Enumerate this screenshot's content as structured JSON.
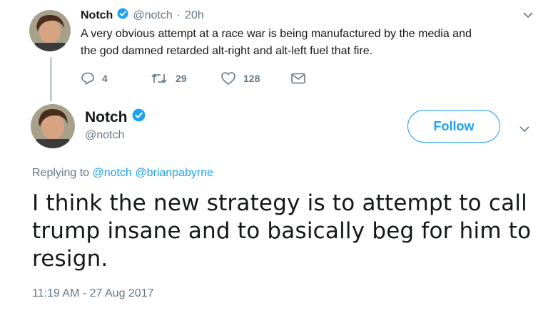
{
  "parent_tweet": {
    "name": "Notch",
    "handle": "@notch",
    "separator": "·",
    "time": "20h",
    "text_line1": "A very obvious attempt at a race war is being manufactured by the media and",
    "text_line2": "the god damned retarded alt-right and alt-left fuel that fire.",
    "reply_count": "4",
    "retweet_count": "29",
    "like_count": "128"
  },
  "main_tweet": {
    "name": "Notch",
    "handle": "@notch",
    "follow_label": "Follow",
    "replying_prefix": "Replying to",
    "reply_to_1": "@notch",
    "reply_to_2": "@brianpabyrne",
    "text_line1": "I think the new strategy is to attempt to call",
    "text_line2": "trump insane and to basically beg for him to",
    "text_line3": "resign.",
    "timestamp": "11:19 AM - 27 Aug 2017"
  },
  "icons": {
    "verified": "verified-badge-icon",
    "caret": "chevron-down-icon",
    "reply": "reply-icon",
    "retweet": "retweet-icon",
    "like": "heart-icon",
    "dm": "envelope-icon"
  },
  "colors": {
    "accent": "#1da1f2",
    "muted": "#657786",
    "text": "#14171a"
  }
}
